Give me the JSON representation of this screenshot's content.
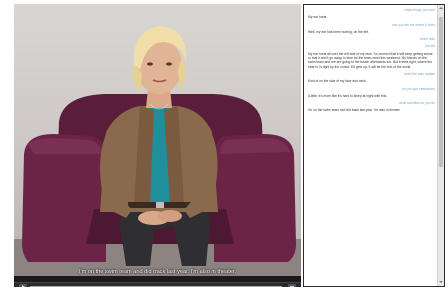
{
  "video": {
    "caption": "I'm on the swim team and did track last year. I'm also in theater.",
    "progress_fraction": 1.0,
    "icons": {
      "play": "play-icon",
      "end": "stop-icon"
    }
  },
  "transcript": {
    "messages": [
      {
        "role": "user",
        "text": "what brings you here"
      },
      {
        "role": "agent",
        "text": "My ear hurts."
      },
      {
        "role": "user",
        "text": "can you tell me where it hurts"
      },
      {
        "role": "agent",
        "text": "Well, my ear has been hurting, on the left."
      },
      {
        "role": "user",
        "text": "which side"
      },
      {
        "role": "user",
        "text": "the left"
      },
      {
        "role": "agent",
        "text": "My ear hurts all over the left side of my face. I'm worried that it will keep getting worse or that it won't go away, in time for the team meet this weekend. My friends on the swim team and me are going to the beach afterwards too. But it feels right, where the heat is, is right by the crowd. If it gets up, it will be the end of the world."
      },
      {
        "role": "user",
        "text": "does the pain radiate"
      },
      {
        "role": "agent",
        "text": "Kind of on the side of my face and neck."
      },
      {
        "role": "user",
        "text": "do you get headaches"
      },
      {
        "role": "agent",
        "text": "A little, it's more like it's hard to sleep at night with this."
      },
      {
        "role": "user",
        "text": "what activities do you do"
      },
      {
        "role": "agent",
        "text": "I'm on the swim team and did track last year. I'm also in theater."
      }
    ]
  },
  "colors": {
    "user_text": "#7ba9c9",
    "agent_text": "#333333",
    "chair": "#5a1e3a",
    "cardigan": "#8a6a4c",
    "top": "#1f8f9c"
  }
}
